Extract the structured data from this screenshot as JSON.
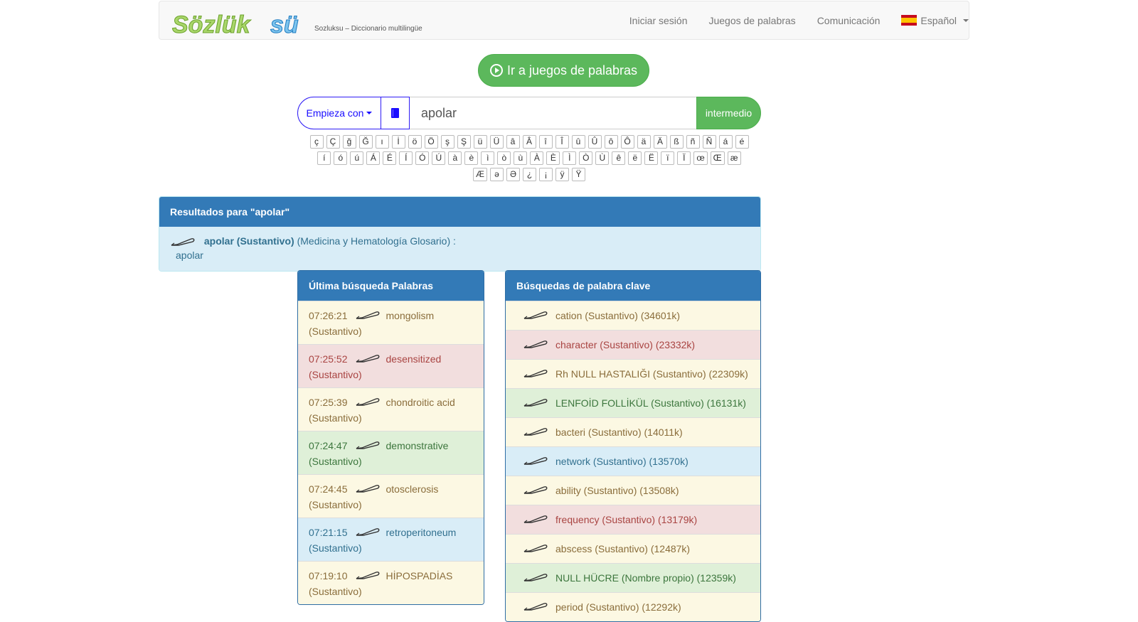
{
  "brand": {
    "logo_text": "Sözlüksü",
    "subtitle": "Sozluksu – Diccionario multilingüe"
  },
  "nav": {
    "login": "Iniciar sesión",
    "word_games": "Juegos de palabras",
    "communication": "Comunicación",
    "language": "Español"
  },
  "games_button": {
    "label": "Ir a juegos de palabras"
  },
  "search": {
    "mode": "Empieza con",
    "query": "apolar",
    "level": "intermedio"
  },
  "special_chars": [
    "ç",
    "Ç",
    "ğ",
    "Ğ",
    "ı",
    "İ",
    "ö",
    "Ö",
    "ş",
    "Ş",
    "ü",
    "Ü",
    "â",
    "Â",
    "î",
    "Î",
    "û",
    "Û",
    "ô",
    "Ô",
    "ä",
    "Ä",
    "ß",
    "ñ",
    "Ñ",
    "á",
    "é",
    "í",
    "ó",
    "ú",
    "Á",
    "É",
    "Í",
    "Ó",
    "Ú",
    "à",
    "è",
    "ì",
    "ò",
    "ù",
    "À",
    "È",
    "Ì",
    "Ò",
    "Ù",
    "ê",
    "ë",
    "Ë",
    "ï",
    "Ï",
    "œ",
    "Œ",
    "æ",
    "Æ",
    "ə",
    "Ə",
    "¿",
    "¡",
    "ÿ",
    "Ÿ"
  ],
  "results": {
    "title": "Resultados para \"apolar\"",
    "term": "apolar (Sustantivo)",
    "glossary": "(Medicina y Hematología Glosario) :",
    "translation": "apolar"
  },
  "recent": {
    "title": "Última búsqueda Palabras",
    "items": [
      {
        "time": "07:26:21",
        "word": "mongolism",
        "pos": "(Sustantivo)",
        "style": "warning"
      },
      {
        "time": "07:25:52",
        "word": "desensitized",
        "pos": "(Sustantivo)",
        "style": "danger"
      },
      {
        "time": "07:25:39",
        "word": "chondroitic acid",
        "pos": "(Sustantivo)",
        "style": "warning"
      },
      {
        "time": "07:24:47",
        "word": "demonstrative",
        "pos": "(Sustantivo)",
        "style": "success"
      },
      {
        "time": "07:24:45",
        "word": "otosclerosis",
        "pos": "(Sustantivo)",
        "style": "warning"
      },
      {
        "time": "07:21:15",
        "word": "retroperitoneum",
        "pos": "(Sustantivo)",
        "style": "info"
      },
      {
        "time": "07:19:10",
        "word": "HİPOSPADİAS",
        "pos": "(Sustantivo)",
        "style": "warning"
      }
    ]
  },
  "keywords": {
    "title": "Búsquedas de palabra clave",
    "items": [
      {
        "text": "cation (Sustantivo) (34601k)",
        "style": "warning"
      },
      {
        "text": "character (Sustantivo) (23332k)",
        "style": "danger"
      },
      {
        "text": "Rh NULL HASTALIĞI (Sustantivo) (22309k)",
        "style": "warning"
      },
      {
        "text": "LENFOİD FOLLİKÜL (Sustantivo) (16131k)",
        "style": "success"
      },
      {
        "text": "bacteri (Sustantivo) (14011k)",
        "style": "warning"
      },
      {
        "text": "network (Sustantivo) (13570k)",
        "style": "info"
      },
      {
        "text": "ability (Sustantivo) (13508k)",
        "style": "warning"
      },
      {
        "text": "frequency (Sustantivo) (13179k)",
        "style": "danger"
      },
      {
        "text": "abscess (Sustantivo) (12487k)",
        "style": "warning"
      },
      {
        "text": "NULL HÜCRE (Nombre propio) (12359k)",
        "style": "success"
      },
      {
        "text": "period (Sustantivo) (12292k)",
        "style": "warning"
      }
    ]
  }
}
